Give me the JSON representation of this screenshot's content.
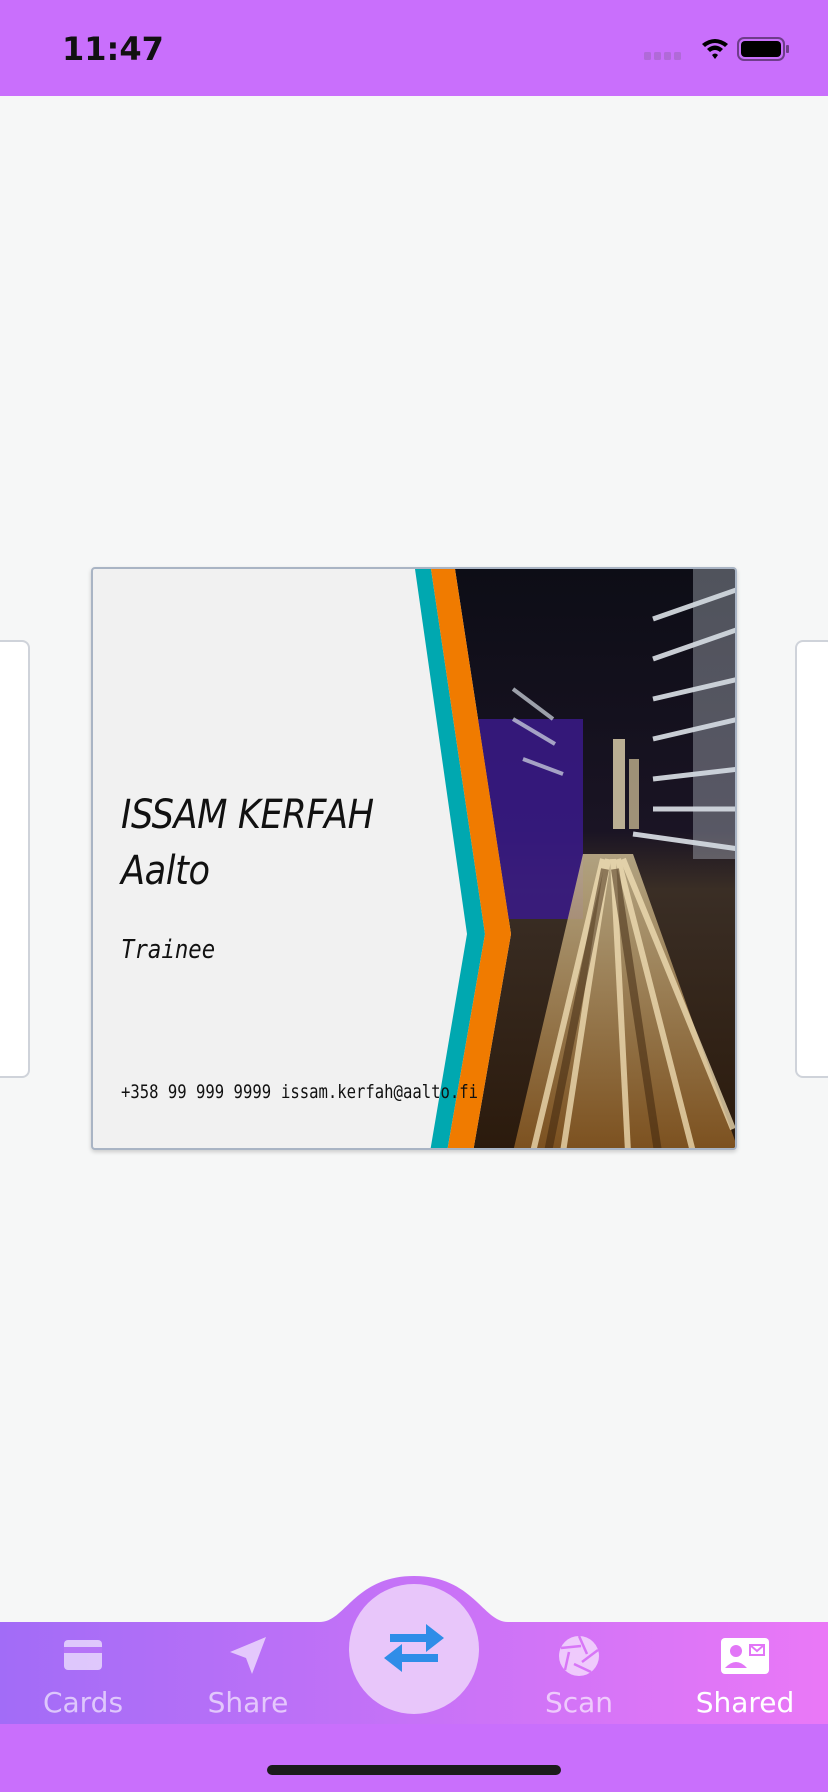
{
  "status_bar": {
    "time": "11:47",
    "icons": [
      "signal-icon",
      "wifi-icon",
      "battery-icon"
    ]
  },
  "card": {
    "name_line1": "ISSAM KERFAH",
    "name_line2": "Aalto",
    "job_title": "Trainee",
    "phone": "+358 99 999 9999",
    "email": "issam.kerfah@aalto.fi",
    "accent_colors": [
      "#00a8b0",
      "#f07b00"
    ]
  },
  "tabbar": {
    "tabs": [
      {
        "label": "Cards",
        "icon": "credit-card-icon",
        "active": false
      },
      {
        "label": "Share",
        "icon": "send-icon",
        "active": false
      },
      {
        "label": "Scan",
        "icon": "aperture-icon",
        "active": false
      },
      {
        "label": "Shared",
        "icon": "contact-mail-icon",
        "active": true
      }
    ],
    "center_button_icon": "swap-arrows-icon",
    "colors": {
      "gradient_start": "#a26cf7",
      "gradient_end": "#ea78f7",
      "fab": "#e8c6fa",
      "fab_icon": "#2f8de8"
    }
  }
}
